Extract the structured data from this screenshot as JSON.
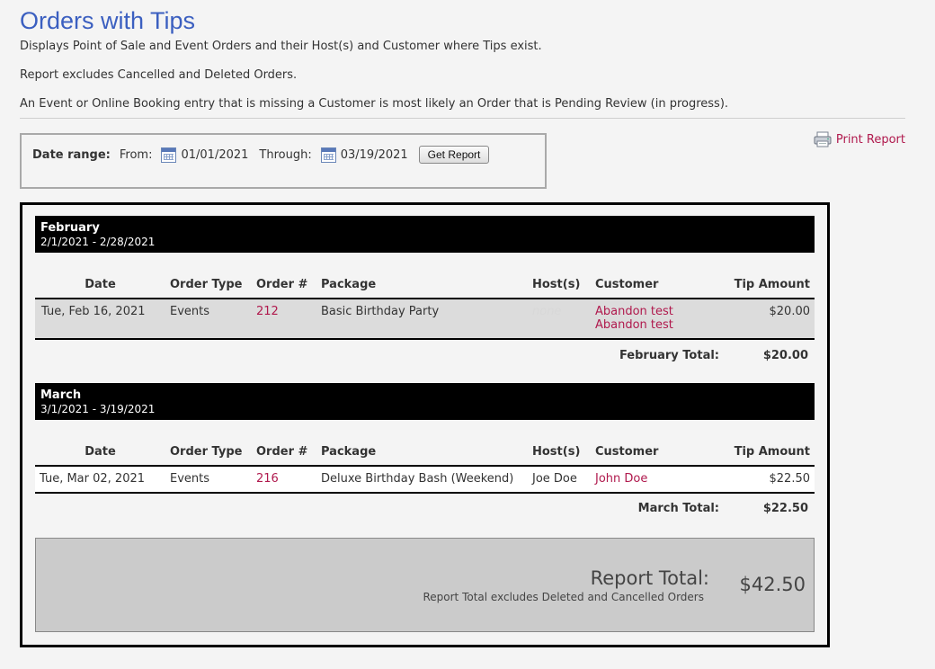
{
  "page": {
    "title": "Orders with Tips",
    "desc1": "Displays Point of Sale and Event Orders and their Host(s) and Customer where Tips exist.",
    "desc2": "Report excludes Cancelled and Deleted Orders.",
    "desc3": "An Event or Online Booking entry that is missing a Customer is most likely an Order that is Pending Review (in progress)."
  },
  "filter": {
    "label": "Date range:",
    "from_label": "From:",
    "from_value": "01/01/2021",
    "through_label": "Through:",
    "through_value": "03/19/2021",
    "button": "Get Report"
  },
  "print": {
    "label": "Print Report",
    "icon": "printer-icon"
  },
  "columns": [
    "Date",
    "Order Type",
    "Order #",
    "Package",
    "Host(s)",
    "Customer",
    "Tip Amount"
  ],
  "months": [
    {
      "name": "February",
      "range": "2/1/2021 - 2/28/2021",
      "rows": [
        {
          "date": "Tue, Feb 16, 2021",
          "type": "Events",
          "order": "212",
          "package": "Basic Birthday Party",
          "host": "none",
          "customer1": "Abandon test",
          "customer2": "Abandon test",
          "tip": "$20.00"
        }
      ],
      "total_label": "February Total:",
      "total": "$20.00"
    },
    {
      "name": "March",
      "range": "3/1/2021 - 3/19/2021",
      "rows": [
        {
          "date": "Tue, Mar 02, 2021",
          "type": "Events",
          "order": "216",
          "package": "Deluxe Birthday Bash (Weekend)",
          "host": "Joe Doe",
          "customer1": "John Doe",
          "tip": "$22.50"
        }
      ],
      "total_label": "March Total:",
      "total": "$22.50"
    }
  ],
  "grand": {
    "label": "Report Total:",
    "sub": "Report Total excludes Deleted and Cancelled Orders",
    "value": "$42.50"
  },
  "colors": {
    "title": "#3b5fc0",
    "link": "#b0194d",
    "header_bg": "#000000",
    "row_grey": "#dcdcdc"
  }
}
